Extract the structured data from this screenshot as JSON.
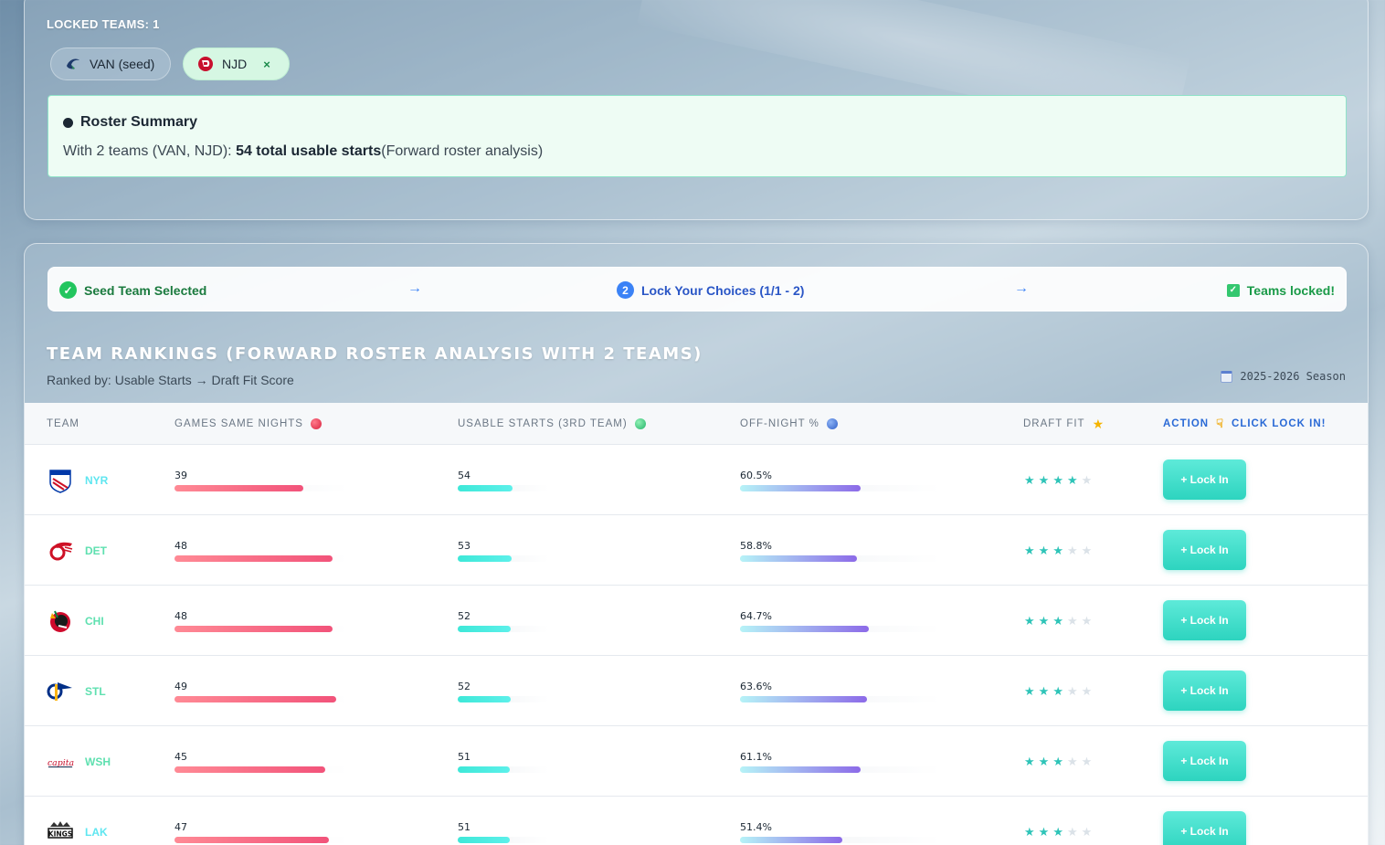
{
  "locked": {
    "label": "LOCKED TEAMS: 1",
    "chips": [
      {
        "label": "VAN (seed)",
        "icon": "canucks-logo-icon"
      },
      {
        "label": "NJD",
        "icon": "devils-logo-icon",
        "close": "×"
      }
    ]
  },
  "summary": {
    "title": "Roster Summary",
    "prefix": "With 2 teams (VAN, NJD): ",
    "bold": "54 total usable starts",
    "suffix": "(Forward roster analysis)"
  },
  "steps": [
    {
      "label": "Seed Team Selected",
      "icon": "check-circle-icon"
    },
    {
      "label": "Lock Your Choices (1/1 - 2)",
      "number": "2"
    },
    {
      "label": "Teams locked!",
      "icon": "checkbox-icon"
    }
  ],
  "arrow": "→",
  "rankings": {
    "title": "TEAM RANKINGS (FORWARD ROSTER ANALYSIS WITH 2 TEAMS)",
    "subtitle": "Ranked by: Usable Starts → Draft Fit Score",
    "season": "2025-2026 Season"
  },
  "columns": {
    "team": "TEAM",
    "games_same_nights": "GAMES SAME NIGHTS",
    "usable_starts": "USABLE STARTS (3RD TEAM)",
    "off_night": "OFF-NIGHT %",
    "draft_fit": "DRAFT FIT",
    "action": "ACTION",
    "action_hint": "CLICK LOCK IN!"
  },
  "colors": {
    "games_dot": "#e0344f",
    "starts_dot": "#33c87a",
    "offnight_dot": "#3a6fd8"
  },
  "lock_label": "+ Lock In",
  "teams": [
    {
      "abbr": "NYR",
      "abbr_color": "#5ee6f0",
      "games": "39",
      "games_pct": 0.74,
      "starts": "54",
      "starts_pct": 0.6,
      "offnight": "60.5%",
      "offnight_pct": 0.6,
      "stars": 4
    },
    {
      "abbr": "DET",
      "abbr_color": "#5fe0b0",
      "games": "48",
      "games_pct": 0.91,
      "starts": "53",
      "starts_pct": 0.59,
      "offnight": "58.8%",
      "offnight_pct": 0.58,
      "stars": 3
    },
    {
      "abbr": "CHI",
      "abbr_color": "#5fe0b0",
      "games": "48",
      "games_pct": 0.91,
      "starts": "52",
      "starts_pct": 0.58,
      "offnight": "64.7%",
      "offnight_pct": 0.64,
      "stars": 3
    },
    {
      "abbr": "STL",
      "abbr_color": "#5fe0b0",
      "games": "49",
      "games_pct": 0.93,
      "starts": "52",
      "starts_pct": 0.58,
      "offnight": "63.6%",
      "offnight_pct": 0.63,
      "stars": 3
    },
    {
      "abbr": "WSH",
      "abbr_color": "#5fe0b0",
      "games": "45",
      "games_pct": 0.87,
      "starts": "51",
      "starts_pct": 0.57,
      "offnight": "61.1%",
      "offnight_pct": 0.6,
      "stars": 3
    },
    {
      "abbr": "LAK",
      "abbr_color": "#5ee6f0",
      "games": "47",
      "games_pct": 0.89,
      "starts": "51",
      "starts_pct": 0.57,
      "offnight": "51.4%",
      "offnight_pct": 0.51,
      "stars": 3
    }
  ]
}
